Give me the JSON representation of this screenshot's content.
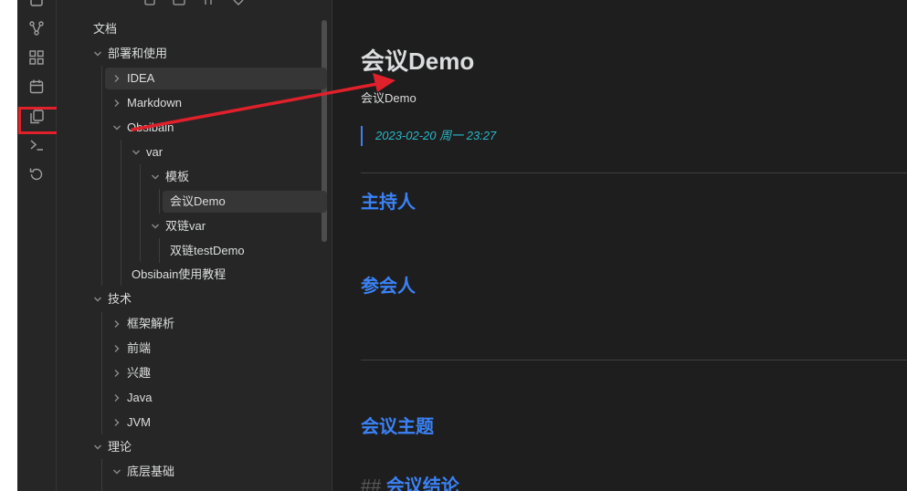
{
  "sidebar": {
    "root": "文档",
    "tree": [
      {
        "label": "部署和使用",
        "state": "expanded"
      },
      {
        "label": "IDEA",
        "state": "collapsed"
      },
      {
        "label": "Markdown",
        "state": "collapsed"
      },
      {
        "label": "Obsibain",
        "state": "expanded"
      },
      {
        "label": "var",
        "state": "expanded"
      },
      {
        "label": "模板",
        "state": "expanded"
      },
      {
        "label": "会议Demo",
        "state": "file",
        "active": true
      },
      {
        "label": "双链var",
        "state": "expanded"
      },
      {
        "label": "双链testDemo",
        "state": "file"
      },
      {
        "label": "Obsibain使用教程",
        "state": "file"
      },
      {
        "label": "技术",
        "state": "expanded"
      },
      {
        "label": "框架解析",
        "state": "collapsed"
      },
      {
        "label": "前端",
        "state": "collapsed"
      },
      {
        "label": "兴趣",
        "state": "collapsed"
      },
      {
        "label": "Java",
        "state": "collapsed"
      },
      {
        "label": "JVM",
        "state": "collapsed"
      },
      {
        "label": "理论",
        "state": "expanded"
      },
      {
        "label": "底层基础",
        "state": "expanded"
      }
    ]
  },
  "ribbon": {
    "icons": [
      "graph-icon",
      "grid-icon",
      "calendar-icon",
      "copy-icon",
      "terminal-icon",
      "history-icon"
    ],
    "highlighted": "copy-icon"
  },
  "editor": {
    "title": "会议Demo",
    "subtitle": "会议Demo",
    "quote": "2023-02-20 周一 23:27",
    "headings": {
      "host": "主持人",
      "attendees": "参会人",
      "topic": "会议主题",
      "conclusion_marker": "##",
      "conclusion": "会议结论"
    }
  },
  "colors": {
    "background": "#1e1e1e",
    "sidebar": "#262626",
    "heading": "#3b82f6",
    "quote_text": "#2bb8c9",
    "annotation": "#e0202a"
  }
}
